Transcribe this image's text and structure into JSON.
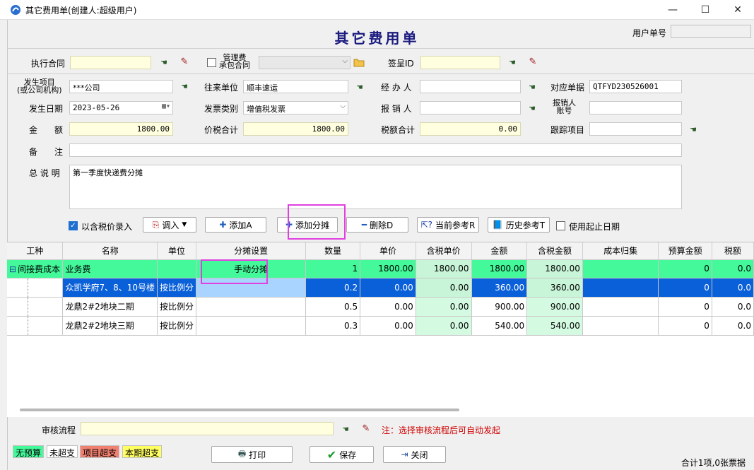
{
  "window": {
    "title": "其它费用单(创建人:超级用户)",
    "minimize": "—",
    "maximize": "☐",
    "close": "✕"
  },
  "form": {
    "heading": "其它费用单",
    "user_no_label": "用户单号",
    "user_no_value": ""
  },
  "contract": {
    "label": "执行合同",
    "value": "",
    "mgmt_fee_label_1": "管理费",
    "mgmt_fee_label_2": "承包合同",
    "mgmt_fee_checked": false,
    "mgmt_select_value": "",
    "sign_label": "签呈ID",
    "sign_value": ""
  },
  "fields": {
    "project_label_1": "发生项目",
    "project_label_2": "(或公司机构)",
    "project_value": "***公司",
    "partner_label": "往来单位",
    "partner_value": "顺丰速运",
    "handler_label": "经 办 人",
    "handler_value": "",
    "ref_label": "对应单据",
    "ref_value": "QTFYD230526001",
    "date_label": "发生日期",
    "date_value": "2023-05-26",
    "invoice_label": "发票类别",
    "invoice_value": "增值税发票",
    "reimburser_label": "报 销 人",
    "reimburser_value": "",
    "account_label_1": "报销人",
    "account_label_2": "账号",
    "account_value": "",
    "amount_label": "金　　额",
    "amount_value": "1800.00",
    "total_tax_label": "价税合计",
    "total_tax_value": "1800.00",
    "tax_label": "税额合计",
    "tax_value": "0.00",
    "track_label": "跟踪项目",
    "track_value": "",
    "remark_label": "备　　注",
    "remark_value": "",
    "summary_label": "总 说 明",
    "summary_value": "第一季度快递费分摊"
  },
  "toolbar": {
    "tax_entry_label": "以含税价录入",
    "tax_entry_checked": true,
    "import_label": "调入",
    "add_label": "添加A",
    "add_alloc_label": "添加分摊",
    "delete_label": "删除D",
    "current_ref_label": "当前参考R",
    "history_ref_label": "历史参考T",
    "use_date_label": "使用起止日期",
    "use_date_checked": false
  },
  "table": {
    "columns": [
      "工种",
      "名称",
      "单位",
      "分摊设置",
      "数量",
      "单价",
      "含税单价",
      "金额",
      "含税金额",
      "成本归集",
      "预算金额",
      "税额"
    ],
    "group_row": {
      "toggle": "⊟",
      "type": "间接费成本",
      "name": "业务费",
      "unit": "",
      "alloc": "手动分摊",
      "qty": "1",
      "price": "1800.00",
      "tax_price": "1800.00",
      "amount": "1800.00",
      "tax_amount": "1800.00",
      "cost": "",
      "budget": "0",
      "tax": "0.0"
    },
    "rows": [
      {
        "name": "众凯学府7、8、10号楼",
        "unit": "按比例分",
        "alloc": "",
        "qty": "0.2",
        "price": "0.00",
        "tax_price": "0.00",
        "amount": "360.00",
        "tax_amount": "360.00",
        "cost": "",
        "budget": "0",
        "tax": "0.0"
      },
      {
        "name": "龙鼎2#2地块二期",
        "unit": "按比例分",
        "alloc": "",
        "qty": "0.5",
        "price": "0.00",
        "tax_price": "0.00",
        "amount": "900.00",
        "tax_amount": "900.00",
        "cost": "",
        "budget": "0",
        "tax": "0.0"
      },
      {
        "name": "龙鼎2#2地块三期",
        "unit": "按比例分",
        "alloc": "",
        "qty": "0.3",
        "price": "0.00",
        "tax_price": "0.00",
        "amount": "540.00",
        "tax_amount": "540.00",
        "cost": "",
        "budget": "0",
        "tax": "0.0"
      }
    ]
  },
  "audit": {
    "label": "审核流程",
    "value": "",
    "note": "注：选择审核流程后可自动发起"
  },
  "legend": {
    "no_budget": "无预算",
    "not_over": "未超支",
    "item_over": "项目超支",
    "period_over": "本期超支"
  },
  "buttons": {
    "print": "打印",
    "save": "保存",
    "close": "关闭"
  },
  "footer": {
    "summary": "合计1项,0张票据"
  },
  "colors": {
    "heading": "#1b1b80",
    "group_row": "#43f99a",
    "selected_row": "#0a60d8",
    "highlight_box": "#e040e0",
    "legend_no_budget": "#43f99a",
    "legend_item_over": "#f08070",
    "legend_period_over": "#ffff60",
    "note_red": "#d00000"
  }
}
